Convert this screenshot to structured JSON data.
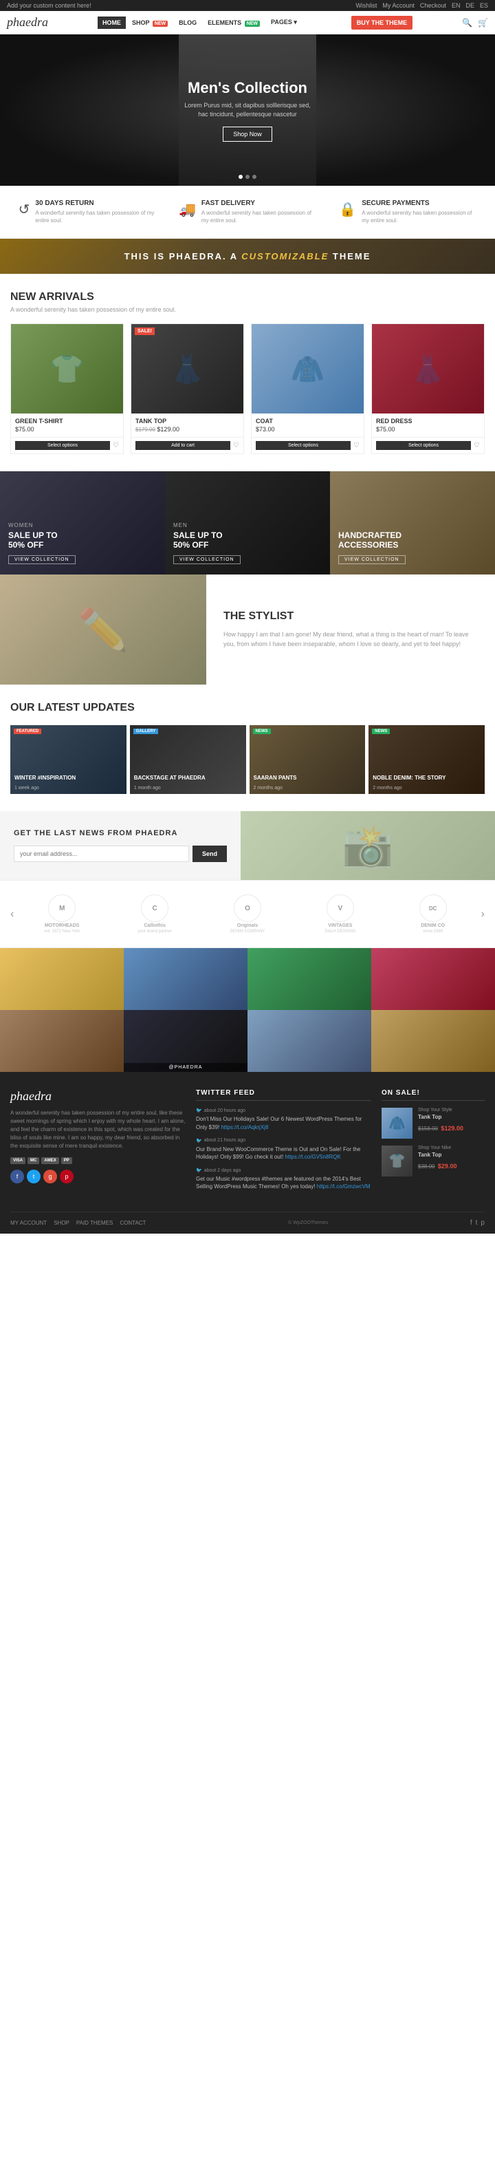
{
  "topbar": {
    "left_text": "Add your custom content here!",
    "wishlist": "Wishlist",
    "account": "My Account",
    "checkout": "Checkout",
    "lang1": "EN",
    "lang2": "DE",
    "lang3": "ES"
  },
  "navbar": {
    "logo": "phaedra",
    "links": [
      {
        "label": "HOME",
        "active": true,
        "badge": null
      },
      {
        "label": "SHOP",
        "active": false,
        "badge": "NEW"
      },
      {
        "label": "BLOG",
        "active": false,
        "badge": null
      },
      {
        "label": "ELEMENTS",
        "active": false,
        "badge": "NEW"
      },
      {
        "label": "PAGES",
        "active": false,
        "badge": null
      }
    ],
    "buy_btn": "BUY THE THEME"
  },
  "hero": {
    "title": "Men's Collection",
    "subtitle": "Lorem Purus mid, sit dapibus solllerisque sed, hac tincidunt, pellentesque nascetur",
    "btn": "Shop Now",
    "dots": [
      true,
      false,
      false
    ]
  },
  "features": [
    {
      "icon": "refresh",
      "title": "30 DAYS RETURN",
      "text": "A wonderful serenity has taken possession of my entire soul."
    },
    {
      "icon": "truck",
      "title": "FAST DELIVERY",
      "text": "A wonderful serenity has taken possession of my entire soul."
    },
    {
      "icon": "lock",
      "title": "SECURE PAYMENTS",
      "text": "A wonderful serenity has taken possession of my entire soul."
    }
  ],
  "custom_banner": {
    "text_before": "THIS IS PHAEDRA. A ",
    "text_em": "CUSTOMIZABLE",
    "text_after": " THEME"
  },
  "new_arrivals": {
    "title": "NEW ARRIVALS",
    "subtitle": "A wonderful serenity has taken possession of my entire soul.",
    "products": [
      {
        "name": "GREEN T-SHIRT",
        "price": "$75.00",
        "old_price": null,
        "badge": null,
        "img_class": "product-img-shirt",
        "btn": "Select options"
      },
      {
        "name": "TANK TOP",
        "price": "$129.00",
        "old_price": "$179.00",
        "badge": "SALE!",
        "img_class": "product-img-tanktop",
        "btn": "Add to cart"
      },
      {
        "name": "COAT",
        "price": "$73.00",
        "old_price": null,
        "badge": null,
        "img_class": "product-img-coat",
        "btn": "Select options"
      },
      {
        "name": "RED DRESS",
        "price": "$75.00",
        "old_price": null,
        "badge": null,
        "img_class": "product-img-dress",
        "btn": "Select options"
      }
    ]
  },
  "sale_banners": [
    {
      "label": "WOMEN",
      "title": "SALE UP TO\n50% OFF",
      "btn": "VIEW COLLECTION",
      "img_class": "sale-banner-women"
    },
    {
      "label": "MEN",
      "title": "SALE UP TO\n50% OFF",
      "btn": "VIEW COLLECTION",
      "img_class": "sale-banner-men"
    },
    {
      "label": "",
      "title": "HANDCRAFTED\nACCESSORIES",
      "btn": "VIEW COLLECTION",
      "img_class": "sale-banner-hand"
    }
  ],
  "stylist": {
    "title": "THE STYLIST",
    "text": "How happy I am that I am gone! My dear friend, what a thing is the heart of man! To leave you, from whom I have been inseparable, whom I love so dearly, and yet to feel happy!"
  },
  "latest_updates": {
    "title": "OUR LATEST UPDATES",
    "posts": [
      {
        "badge": "FEATURED",
        "badge_class": "update-badge-featured",
        "title": "WINTER #INSPIRATION",
        "date": "1 week ago",
        "img_class": "update-card-1"
      },
      {
        "badge": "GALLERY",
        "badge_class": "update-badge-gallery",
        "title": "BACKSTAGE AT PHAEDRA",
        "date": "1 month ago",
        "img_class": "update-card-2"
      },
      {
        "badge": "NEWS",
        "badge_class": "update-badge-news",
        "title": "SAARAN PANTS",
        "date": "2 months ago",
        "img_class": "update-card-3"
      },
      {
        "badge": "NEWS",
        "badge_class": "update-badge-news",
        "title": "NOBLE DENIM: THE STORY",
        "date": "2 months ago",
        "img_class": "update-card-4"
      }
    ]
  },
  "newsletter": {
    "title": "GET THE LAST NEWS FROM PHAEDRA",
    "placeholder": "your email address...",
    "btn": "Send"
  },
  "brands": [
    {
      "icon": "M",
      "name": "MOTORHEADS",
      "sub": "est. 1972 New York"
    },
    {
      "icon": "C",
      "name": "Calliothis",
      "sub": "your brand partner"
    },
    {
      "icon": "O",
      "name": "Originals",
      "sub": "DENIM COMPANY"
    },
    {
      "icon": "V",
      "name": "VINTAGES",
      "sub": "DALH DESIGNS"
    },
    {
      "icon": "DC",
      "name": "DENIM CO",
      "sub": "since 1989"
    }
  ],
  "instagram": {
    "handle": "@phaedra",
    "items": [
      {
        "color": "#e8c060"
      },
      {
        "color": "#6090c0"
      },
      {
        "color": "#40a060"
      },
      {
        "color": "#c04060"
      },
      {
        "color": "#a08060"
      },
      {
        "color": "#2a2a3a"
      },
      {
        "color": "#80a0c0"
      },
      {
        "color": "#c0a060"
      }
    ]
  },
  "footer": {
    "logo": "phaedra",
    "description": "A wonderful serenity has taken possession of my entire soul, like these sweet mornings of spring which I enjoy with my whole heart. I am alone, and feel the charm of existence in this spot, which was created for the bliss of souls like mine. I am so happy, my dear friend, so absorbed in the exquisite sense of mere tranquil existence.",
    "pay_methods": [
      "VISA",
      "MC",
      "AMEX",
      "PP"
    ],
    "social": [
      "f",
      "t",
      "g+",
      "p"
    ],
    "twitter_title": "TWITTER FEED",
    "tweets": [
      {
        "time": "about 20 hours ago",
        "text": "Don't Miss Our Holidays Sale! Our 6 Newest WordPress Themes for Only $39! https://t.co/AqkrjXj8",
        "link": "https://t.co/AqkrjXj8"
      },
      {
        "time": "about 21 hours ago",
        "text": "Our Brand New WooCommerce Theme is Out and On Sale! For the Holidays! Only $99! Go check it out! https://t.co/GV5n8RQK",
        "link": "https://t.co/GV5n8RQK"
      },
      {
        "time": "about 2 days ago",
        "text": "Get our Music #wordpress #themes are featured on the 2014's Best Selling WordPress Music Themes! Oh yes today! https://t.co/GmzwcVM",
        "link": "https://t.co/GmzwcVM"
      }
    ],
    "on_sale_title": "ON SALE!",
    "sale_items": [
      {
        "label": "Shop Your Style",
        "name": "Tank Top",
        "price_old": "$158.00",
        "price_new": "$129.00",
        "img_class": "sale-item-img-1"
      },
      {
        "label": "Shop Your Nike",
        "name": "Tank Top",
        "price_old": "$38.00",
        "price_new": "$29.00",
        "img_class": "sale-item-img-2"
      }
    ],
    "bottom_nav": [
      "MY ACCOUNT",
      "SHOP",
      "PAID THEMES",
      "CONTACT"
    ],
    "credit": "© WpZOOThemes"
  }
}
